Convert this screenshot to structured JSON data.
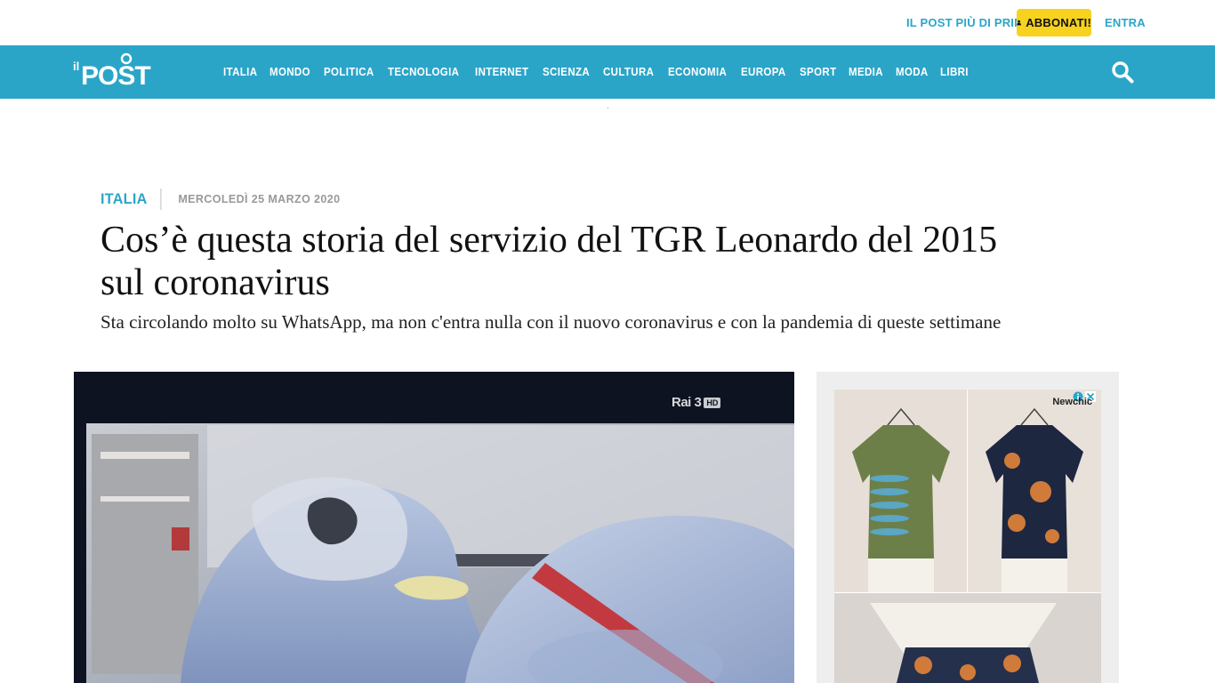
{
  "topbar": {
    "prima_label": "IL POST PIÙ DI PRIMA",
    "abbonati_label": "ABBONATI!",
    "entra_label": "ENTRA"
  },
  "brand": {
    "logo_text": "il POST",
    "accent_color": "#2aa5c8",
    "cta_color": "#f7d21f"
  },
  "nav": {
    "items": [
      "ITALIA",
      "MONDO",
      "POLITICA",
      "TECNOLOGIA",
      "INTERNET",
      "SCIENZA",
      "CULTURA",
      "ECONOMIA",
      "EUROPA",
      "SPORT",
      "MEDIA",
      "MODA",
      "LIBRI"
    ],
    "search_icon": "search-icon"
  },
  "article": {
    "category": "ITALIA",
    "date": "MERCOLEDÌ 25 MARZO 2020",
    "headline": "Cos’è questa storia del servizio del TGR Leonardo del 2015 sul coronavirus",
    "summary": "Sta circolando molto su WhatsApp, ma non c'entra nulla con il nuovo coronavirus e con la pandemia di queste settimane",
    "image_overlay": {
      "channel_logo": "Rai 3",
      "channel_badge": "HD"
    }
  },
  "ad": {
    "brand": "Newchic",
    "icons": [
      "info-icon",
      "close-icon"
    ]
  }
}
